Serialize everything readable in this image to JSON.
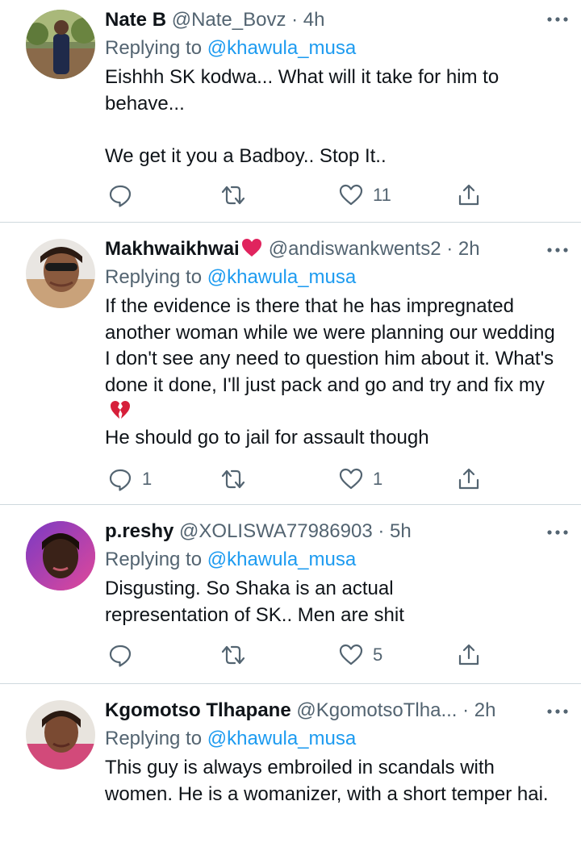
{
  "colors": {
    "link": "#1d9bf0",
    "secondary": "#536471",
    "text": "#0f1419",
    "divider": "#cfd9de",
    "heart": "#e0245e"
  },
  "tweets": [
    {
      "name": "Nate B",
      "handle": "@Nate_Bovz",
      "time": "4h",
      "reply_prefix": "Replying to",
      "reply_to": "@khawula_musa",
      "text": "Eishhh SK kodwa... What will it take for him to behave...\n\nWe get it you a Badboy.. Stop It..",
      "replies": "",
      "retweets": "",
      "likes": "11",
      "avatar_icon": "avatar-photo-man-in-suit"
    },
    {
      "name": "Makhwaikhwai",
      "name_emoji": "red-heart-icon",
      "handle": "@andiswankwents2",
      "time": "2h",
      "reply_prefix": "Replying to",
      "reply_to": "@khawula_musa",
      "text": "If the evidence is there that he has impregnated another woman while we were planning our wedding I don't see any need to question him about it. What's done it done, I'll just pack and go and try and fix my",
      "text_emoji": "broken-heart-icon",
      "text_after": "He should go to jail for assault though",
      "replies": "1",
      "retweets": "",
      "likes": "1",
      "avatar_icon": "avatar-photo-woman-sunglasses"
    },
    {
      "name": "p.reshy",
      "handle": "@XOLISWA77986903",
      "time": "5h",
      "reply_prefix": "Replying to",
      "reply_to": "@khawula_musa",
      "text": "Disgusting. So Shaka is an actual representation of SK.. Men are shit",
      "replies": "",
      "retweets": "",
      "likes": "5",
      "avatar_icon": "avatar-photo-woman-pink"
    },
    {
      "name": "Kgomotso Tlhapane",
      "handle": "@KgomotsoTlha...",
      "time": "2h",
      "reply_prefix": "Replying to",
      "reply_to": "@khawula_musa",
      "text": "This guy is always embroiled in scandals with women. He is a womanizer, with a short temper hai.",
      "avatar_icon": "avatar-photo-woman-selfie"
    }
  ]
}
